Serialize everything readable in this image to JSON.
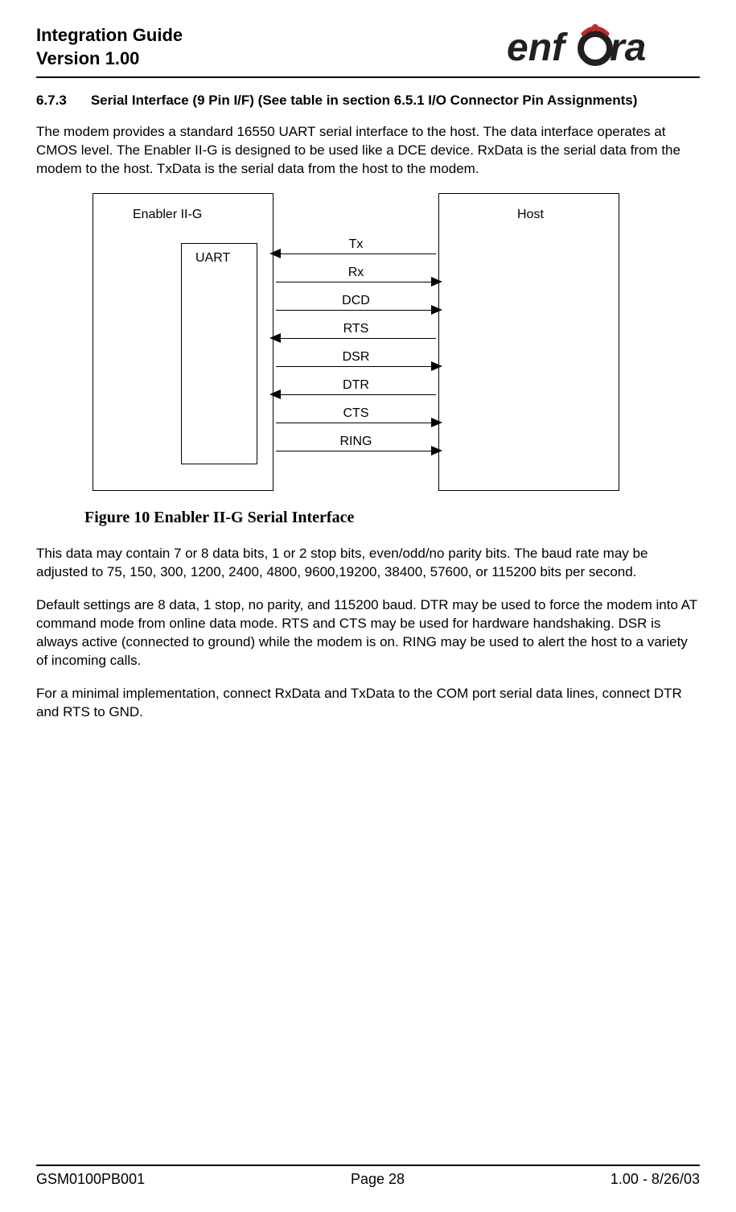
{
  "header": {
    "title_line1": "Integration Guide",
    "title_line2": "Version 1.00",
    "logo_text": "enfora"
  },
  "section": {
    "number": "6.7.3",
    "title": "Serial Interface (9 Pin I/F) (See table in section 6.5.1 I/O Connector Pin Assignments)"
  },
  "paragraphs": {
    "p1": "The modem provides a standard 16550 UART serial interface to the host.  The data interface operates at CMOS level.  The Enabler II-G is designed to be used like a DCE device.  RxData is the serial data from the modem to the host.  TxData is the serial data from the host to the modem.",
    "p2": "This data may contain 7 or 8 data bits, 1 or 2 stop bits, even/odd/no parity bits.  The baud rate may be adjusted to 75, 150, 300, 1200, 2400, 4800, 9600,19200, 38400, 57600, or 115200 bits per second.",
    "p3": "Default settings are 8 data, 1 stop, no parity, and 115200 baud.  DTR may be used to force the modem into AT command mode from online data mode.  RTS and CTS may be used for hardware handshaking.  DSR is always active (connected to ground) while the modem is on.  RING may be used to alert the host to a variety of incoming calls.",
    "p4": "For a minimal implementation, connect RxData and TxData to the COM port serial data lines, connect DTR and RTS to GND."
  },
  "diagram": {
    "enabler_label": "Enabler II-G",
    "uart_label": "UART",
    "host_label": "Host",
    "signals": {
      "s0": "Tx",
      "s1": "Rx",
      "s2": "DCD",
      "s3": "RTS",
      "s4": "DSR",
      "s5": "DTR",
      "s6": "CTS",
      "s7": "RING"
    }
  },
  "figure_caption": "Figure 10 Enabler II-G Serial Interface",
  "footer": {
    "left": "GSM0100PB001",
    "center": "Page 28",
    "right": "1.00 - 8/26/03"
  }
}
